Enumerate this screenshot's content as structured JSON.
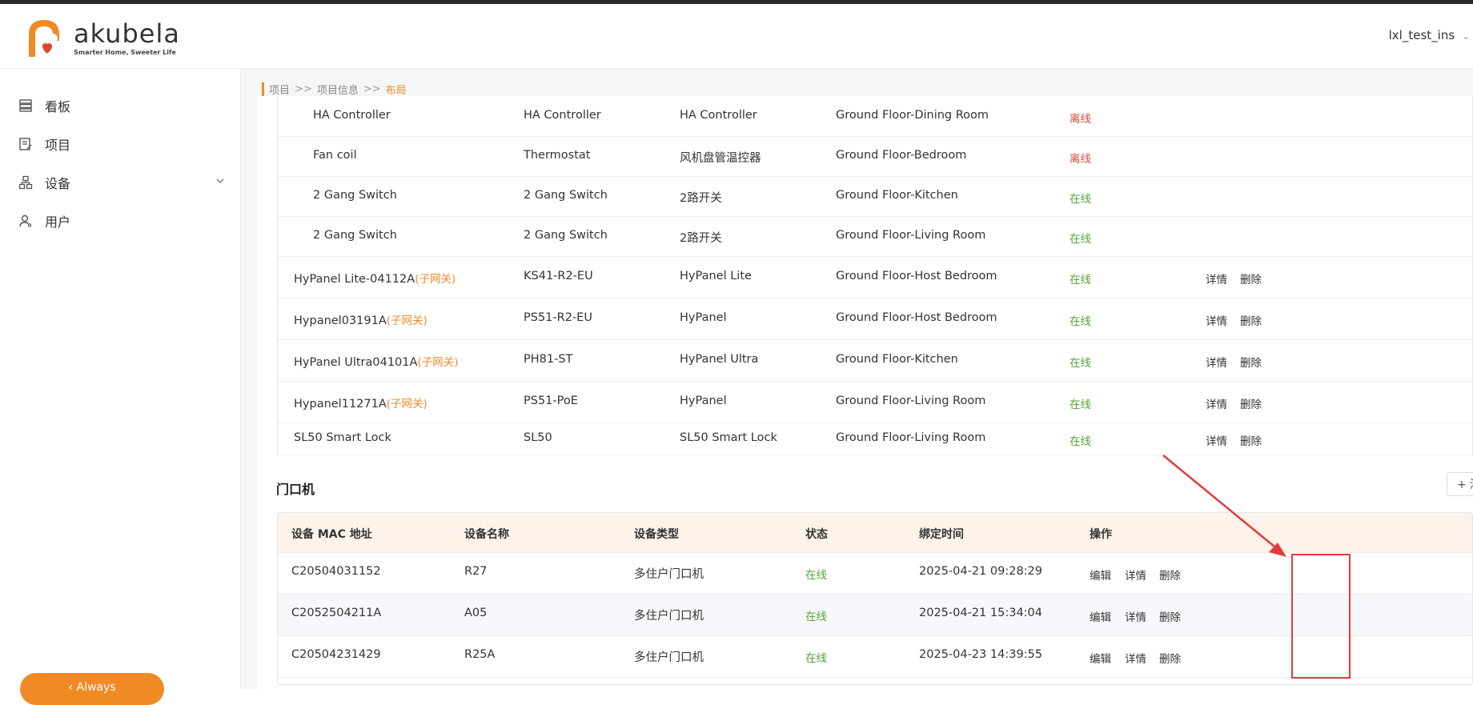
{
  "header": {
    "logo_text": "akubela",
    "logo_tagline": "Smarter Home, Sweeter Life",
    "user_name": "lxl_test_ins"
  },
  "sidebar": {
    "items": [
      {
        "label": "看板",
        "icon": "dashboard-icon"
      },
      {
        "label": "项目",
        "icon": "project-icon"
      },
      {
        "label": "设备",
        "icon": "device-icon"
      },
      {
        "label": "用户",
        "icon": "user-icon"
      }
    ],
    "collapse_label": "‹ Always"
  },
  "breadcrumb": {
    "items": [
      "项目",
      "项目信息",
      "布局"
    ],
    "separator": ">>"
  },
  "device_table": {
    "rows": [
      {
        "name": "HA Controller",
        "tag": "",
        "model": "HA Controller",
        "type": "HA Controller",
        "location": "Ground Floor-Dining Room",
        "status": "离线",
        "actions": []
      },
      {
        "name": "Fan coil",
        "tag": "",
        "model": "Thermostat",
        "type": "风机盘管温控器",
        "location": "Ground Floor-Bedroom",
        "status": "离线",
        "actions": []
      },
      {
        "name": "2 Gang Switch",
        "tag": "",
        "model": "2 Gang Switch",
        "type": "2路开关",
        "location": "Ground Floor-Kitchen",
        "status": "在线",
        "actions": []
      },
      {
        "name": "2 Gang Switch",
        "tag": "",
        "model": "2 Gang Switch",
        "type": "2路开关",
        "location": "Ground Floor-Living Room",
        "status": "在线",
        "actions": []
      },
      {
        "name": "HyPanel Lite-04112A",
        "tag": "(子网关)",
        "model": "KS41-R2-EU",
        "type": "HyPanel Lite",
        "location": "Ground Floor-Host Bedroom",
        "status": "在线",
        "actions": [
          "详情",
          "删除"
        ]
      },
      {
        "name": "Hypanel03191A",
        "tag": "(子网关)",
        "model": "PS51-R2-EU",
        "type": "HyPanel",
        "location": "Ground Floor-Host Bedroom",
        "status": "在线",
        "actions": [
          "详情",
          "删除"
        ]
      },
      {
        "name": "HyPanel Ultra04101A",
        "tag": "(子网关)",
        "model": "PH81-ST",
        "type": "HyPanel Ultra",
        "location": "Ground Floor-Kitchen",
        "status": "在线",
        "actions": [
          "详情",
          "删除"
        ]
      },
      {
        "name": "Hypanel11271A",
        "tag": "(子网关)",
        "model": "PS51-PoE",
        "type": "HyPanel",
        "location": "Ground Floor-Living Room",
        "status": "在线",
        "actions": [
          "详情",
          "删除"
        ]
      },
      {
        "name": "SL50 Smart Lock",
        "tag": "",
        "model": "SL50",
        "type": "SL50 Smart Lock",
        "location": "Ground Floor-Living Room",
        "status": "在线",
        "actions": [
          "详情",
          "删除"
        ]
      }
    ]
  },
  "door_section": {
    "title": "门口机",
    "add_label": "+ 添加",
    "columns": [
      "设备 MAC 地址",
      "设备名称",
      "设备类型",
      "状态",
      "绑定时间",
      "操作"
    ],
    "rows": [
      {
        "mac": "C20504031152",
        "name": "R27",
        "type": "多住户门口机",
        "status": "在线",
        "time": "2025-04-21 09:28:29",
        "actions": [
          "编辑",
          "详情",
          "删除"
        ]
      },
      {
        "mac": "C2052504211A",
        "name": "A05",
        "type": "多住户门口机",
        "status": "在线",
        "time": "2025-04-21 15:34:04",
        "actions": [
          "编辑",
          "详情",
          "删除"
        ]
      },
      {
        "mac": "C20504231429",
        "name": "R25A",
        "type": "多住户门口机",
        "status": "在线",
        "time": "2025-04-23 14:39:55",
        "actions": [
          "编辑",
          "详情",
          "删除"
        ]
      }
    ]
  },
  "colors": {
    "accent": "#f08a24",
    "online": "#52a535",
    "offline": "#e04a3a",
    "annotation": "#e33b3b"
  }
}
